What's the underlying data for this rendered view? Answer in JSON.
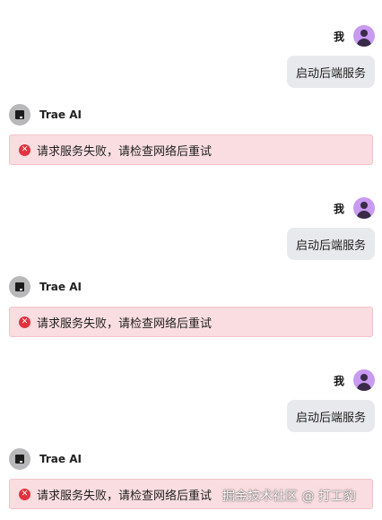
{
  "user": {
    "name": "我"
  },
  "ai": {
    "name": "Trae AI"
  },
  "messages": [
    {
      "user_text": "启动后端服务",
      "error_text": "请求服务失败，请检查网络后重试"
    },
    {
      "user_text": "启动后端服务",
      "error_text": "请求服务失败，请检查网络后重试"
    },
    {
      "user_text": "启动后端服务",
      "error_text": "请求服务失败，请检查网络后重试"
    }
  ],
  "watermark": "掘金技术社区 @ 打工豹",
  "icons": {
    "user_avatar": "user-avatar-icon",
    "ai_avatar": "trae-logo-icon",
    "error": "error-circle-icon"
  },
  "colors": {
    "error_bg": "#f9dde0",
    "error_icon": "#e2323f",
    "user_bubble": "#e8e9ec",
    "user_avatar": "#c89af0"
  }
}
